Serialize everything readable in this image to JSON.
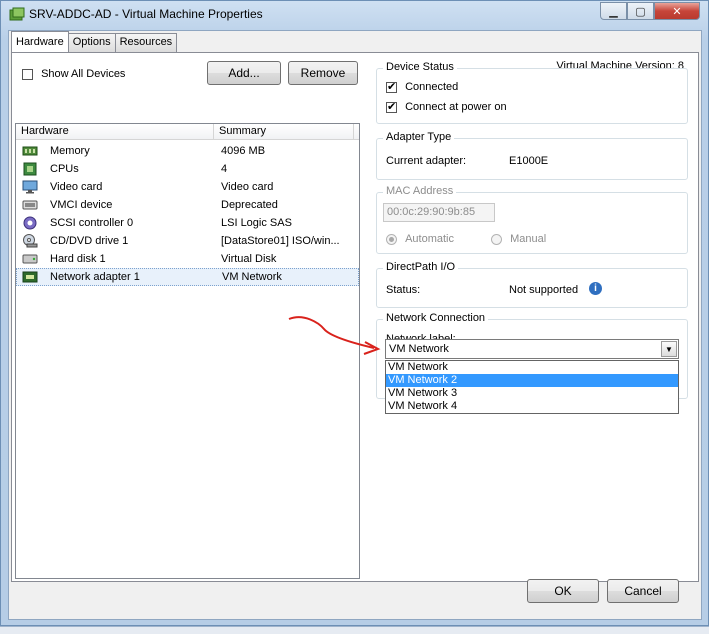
{
  "window": {
    "title": "SRV-ADDC-AD - Virtual Machine Properties",
    "minimize_glyph": "▁",
    "restore_glyph": "▢",
    "close_glyph": "✕"
  },
  "tabs": [
    {
      "label": "Hardware",
      "active": true
    },
    {
      "label": "Options",
      "active": false
    },
    {
      "label": "Resources",
      "active": false
    }
  ],
  "vm_version": "Virtual Machine Version: 8",
  "toolbar": {
    "show_all_devices": "Show All Devices",
    "show_all_checked": false,
    "add_label": "Add...",
    "remove_label": "Remove"
  },
  "hardware_grid": {
    "columns": [
      "Hardware",
      "Summary"
    ],
    "rows": [
      {
        "name": "Memory",
        "summary": "4096 MB",
        "icon": "memory-icon"
      },
      {
        "name": "CPUs",
        "summary": "4",
        "icon": "cpu-icon"
      },
      {
        "name": "Video card",
        "summary": "Video card",
        "icon": "monitor-icon"
      },
      {
        "name": "VMCI device",
        "summary": "Deprecated",
        "icon": "vmci-icon"
      },
      {
        "name": "SCSI controller 0",
        "summary": "LSI Logic SAS",
        "icon": "scsi-icon"
      },
      {
        "name": "CD/DVD drive 1",
        "summary": "[DataStore01] ISO/win...",
        "icon": "cd-dvd-icon"
      },
      {
        "name": "Hard disk 1",
        "summary": "Virtual Disk",
        "icon": "hard-disk-icon"
      },
      {
        "name": "Network adapter 1",
        "summary": "VM Network",
        "icon": "network-adapter-icon",
        "selected": true
      }
    ]
  },
  "device_status": {
    "title": "Device Status",
    "connected": "Connected",
    "connected_checked": true,
    "connect_at_power_on": "Connect at power on",
    "connect_at_power_on_checked": true
  },
  "adapter_type": {
    "title": "Adapter Type",
    "label": "Current adapter:",
    "value": "E1000E"
  },
  "mac_address": {
    "title": "MAC Address",
    "value": "00:0c:29:90:9b:85",
    "automatic": "Automatic",
    "manual": "Manual",
    "selected": "Automatic"
  },
  "directpath": {
    "title": "DirectPath I/O",
    "label": "Status:",
    "value": "Not supported",
    "info_glyph": "i"
  },
  "network_connection": {
    "title": "Network Connection",
    "label": "Network label:",
    "selected": "VM Network",
    "options": [
      "VM Network",
      "VM Network 2",
      "VM Network 3",
      "VM Network 4"
    ],
    "highlighted_index": 1
  },
  "footer": {
    "ok_label": "OK",
    "cancel_label": "Cancel"
  },
  "colors": {
    "highlight": "#3399ff",
    "annotation_arrow": "#d9221c"
  }
}
